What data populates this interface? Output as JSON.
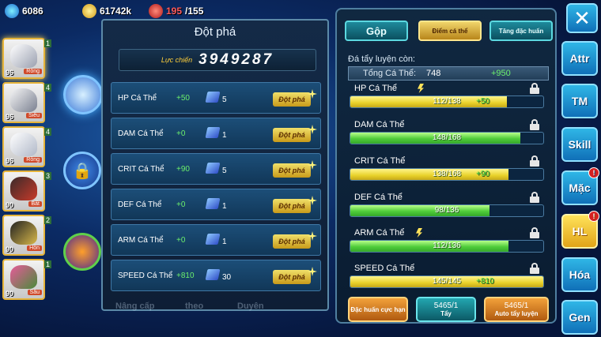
{
  "topbar": {
    "gems": "6086",
    "gold": "61742k",
    "stamina": "195",
    "stamina_max": "/155"
  },
  "team": [
    {
      "level": "96",
      "tag": "Rồng",
      "num": "1"
    },
    {
      "level": "96",
      "tag": "Siêu",
      "num": "4"
    },
    {
      "level": "96",
      "tag": "Rồng",
      "num": "4"
    },
    {
      "level": "90",
      "tag": "Bất",
      "num": "3"
    },
    {
      "level": "90",
      "tag": "Hồn",
      "num": "2"
    },
    {
      "level": "90",
      "tag": "Sâu",
      "num": "1"
    }
  ],
  "left_panel": {
    "title": "Đột phá",
    "power_label": "Lực chiến",
    "power_value": "3949287",
    "button_label": "Đột phá",
    "rows": [
      {
        "name": "HP Cá Thể",
        "plus": "+50",
        "count": "5"
      },
      {
        "name": "DAM Cá Thể",
        "plus": "+0",
        "count": "1"
      },
      {
        "name": "CRIT Cá Thể",
        "plus": "+90",
        "count": "5"
      },
      {
        "name": "DEF Cá Thể",
        "plus": "+0",
        "count": "1"
      },
      {
        "name": "ARM Cá Thể",
        "plus": "+0",
        "count": "1"
      },
      {
        "name": "SPEED Cá Thể",
        "plus": "+810",
        "count": "30"
      }
    ],
    "ghost_labels": [
      "Nâng cấp",
      "theo",
      "Duyên"
    ]
  },
  "right_panel": {
    "tabs": {
      "gop": "Gộp",
      "diem": "Điểm cá thể",
      "tang": "Tăng đặc huấn"
    },
    "remaining_label": "Đá tẩy luyện còn:",
    "total_label": "Tổng Cá Thể:",
    "total_value": "748",
    "total_plus": "+950",
    "stats": [
      {
        "name": "HP Cá Thể",
        "value": "112/138",
        "plus": "+50",
        "fill": 0.81,
        "gold": true
      },
      {
        "name": "DAM Cá Thể",
        "value": "148/168",
        "plus": "",
        "fill": 0.88,
        "gold": false
      },
      {
        "name": "CRIT Cá Thể",
        "value": "138/168",
        "plus": "+90",
        "fill": 0.82,
        "gold": true
      },
      {
        "name": "DEF Cá Thể",
        "value": "98/136",
        "plus": "",
        "fill": 0.72,
        "gold": false
      },
      {
        "name": "ARM Cá Thể",
        "value": "112/136",
        "plus": "",
        "fill": 0.82,
        "gold": false
      },
      {
        "name": "SPEED Cá Thể",
        "value": "145/145",
        "plus": "+810",
        "fill": 1.0,
        "gold": true
      }
    ],
    "bottom_buttons": {
      "special": "Đặc huấn cực hạn",
      "wash_count": "5465/1",
      "wash_label": "Tẩy",
      "auto_count": "5465/1",
      "auto_label": "Auto tẩy luyện"
    }
  },
  "side_buttons": [
    {
      "label": "Attr",
      "badge": ""
    },
    {
      "label": "TM",
      "badge": ""
    },
    {
      "label": "Skill",
      "badge": ""
    },
    {
      "label": "Mặc",
      "badge": "!"
    },
    {
      "label": "HL",
      "badge": "!"
    },
    {
      "label": "Hóa",
      "badge": ""
    },
    {
      "label": "Gen",
      "badge": ""
    }
  ],
  "close_glyph": "✕",
  "lock_glyph": "🔒"
}
